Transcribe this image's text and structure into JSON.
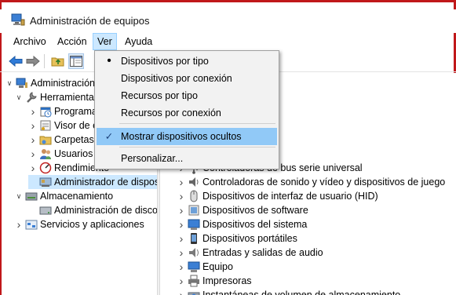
{
  "window": {
    "title": "Administración de equipos"
  },
  "menubar": [
    {
      "label": "Archivo",
      "active": false
    },
    {
      "label": "Acción",
      "active": false
    },
    {
      "label": "Ver",
      "active": true
    },
    {
      "label": "Ayuda",
      "active": false
    }
  ],
  "tree": [
    {
      "label": "Administración de equipos (local)",
      "arrow": "v",
      "icon": "computer-mgmt",
      "indent": 0
    },
    {
      "label": "Herramientas del sistema",
      "arrow": "v",
      "icon": "tools",
      "indent": 1
    },
    {
      "label": "Programador de tareas",
      "arrow": ">",
      "icon": "task-scheduler",
      "indent": 2
    },
    {
      "label": "Visor de eventos",
      "arrow": ">",
      "icon": "event-viewer",
      "indent": 2
    },
    {
      "label": "Carpetas compartidas",
      "arrow": ">",
      "icon": "shared-folder",
      "indent": 2
    },
    {
      "label": "Usuarios y grupos locales",
      "arrow": ">",
      "icon": "users",
      "indent": 2
    },
    {
      "label": "Rendimiento",
      "arrow": ">",
      "icon": "performance",
      "indent": 2
    },
    {
      "label": "Administrador de dispositivos",
      "arrow": "",
      "icon": "device-manager",
      "indent": 2,
      "selected": true
    },
    {
      "label": "Almacenamiento",
      "arrow": "v",
      "icon": "storage",
      "indent": 1
    },
    {
      "label": "Administración de discos",
      "arrow": "",
      "icon": "disk",
      "indent": 2
    },
    {
      "label": "Servicios y aplicaciones",
      "arrow": ">",
      "icon": "services",
      "indent": 1
    }
  ],
  "devices": [
    {
      "label": "antalla",
      "icon": "monitor"
    },
    {
      "label": "ed",
      "icon": "network"
    },
    {
      "label": "n",
      "icon": "generic"
    },
    {
      "label": "A/ATAPI IDE",
      "icon": "ide"
    },
    {
      "label": "lmacenamiento",
      "icon": "storage-ctrl"
    },
    {
      "label": "Controladoras de bus serie universal",
      "icon": "usb"
    },
    {
      "label": "Controladoras de sonido y vídeo y dispositivos de juego",
      "icon": "sound"
    },
    {
      "label": "Dispositivos de interfaz de usuario (HID)",
      "icon": "hid"
    },
    {
      "label": "Dispositivos de software",
      "icon": "software"
    },
    {
      "label": "Dispositivos del sistema",
      "icon": "system"
    },
    {
      "label": "Dispositivos portátiles",
      "icon": "portable"
    },
    {
      "label": "Entradas y salidas de audio",
      "icon": "audio"
    },
    {
      "label": "Equipo",
      "icon": "computer"
    },
    {
      "label": "Impresoras",
      "icon": "printer"
    },
    {
      "label": "Instantáneas de volumen de almacenamiento",
      "icon": "snapshot"
    }
  ],
  "ver_menu": {
    "items": [
      {
        "label": "Dispositivos por tipo",
        "mark": "•",
        "highlighted": false
      },
      {
        "label": "Dispositivos por conexión",
        "mark": "",
        "highlighted": false
      },
      {
        "label": "Recursos por tipo",
        "mark": "",
        "highlighted": false
      },
      {
        "label": "Recursos por conexión",
        "mark": "",
        "highlighted": false
      },
      {
        "label": "Mostrar dispositivos ocultos",
        "mark": "✓",
        "highlighted": true
      },
      {
        "label": "Personalizar...",
        "mark": "",
        "highlighted": false
      }
    ]
  }
}
